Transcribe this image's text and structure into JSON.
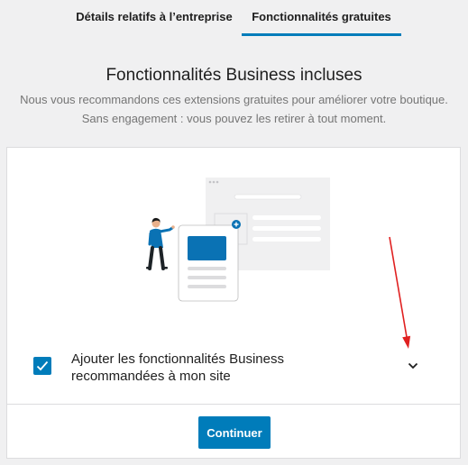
{
  "tabs": [
    {
      "label": "Détails relatifs à l’entreprise",
      "active": false
    },
    {
      "label": "Fonctionnalités gratuites",
      "active": true
    }
  ],
  "heading": "Fonctionnalités Business incluses",
  "subtext": {
    "line1": "Nous vous recommandons ces extensions gratuites pour améliorer votre boutique.",
    "line2": "Sans engagement : vous pouvez les retirer à tout moment."
  },
  "option": {
    "label": "Ajouter les fonctionnalités Business recommandées à mon site",
    "checked": true
  },
  "continue_label": "Continuer",
  "colors": {
    "accent": "#007cba",
    "annotation": "#e02020"
  },
  "icons": [
    "checkmark-icon",
    "chevron-down-icon",
    "plus-icon"
  ]
}
